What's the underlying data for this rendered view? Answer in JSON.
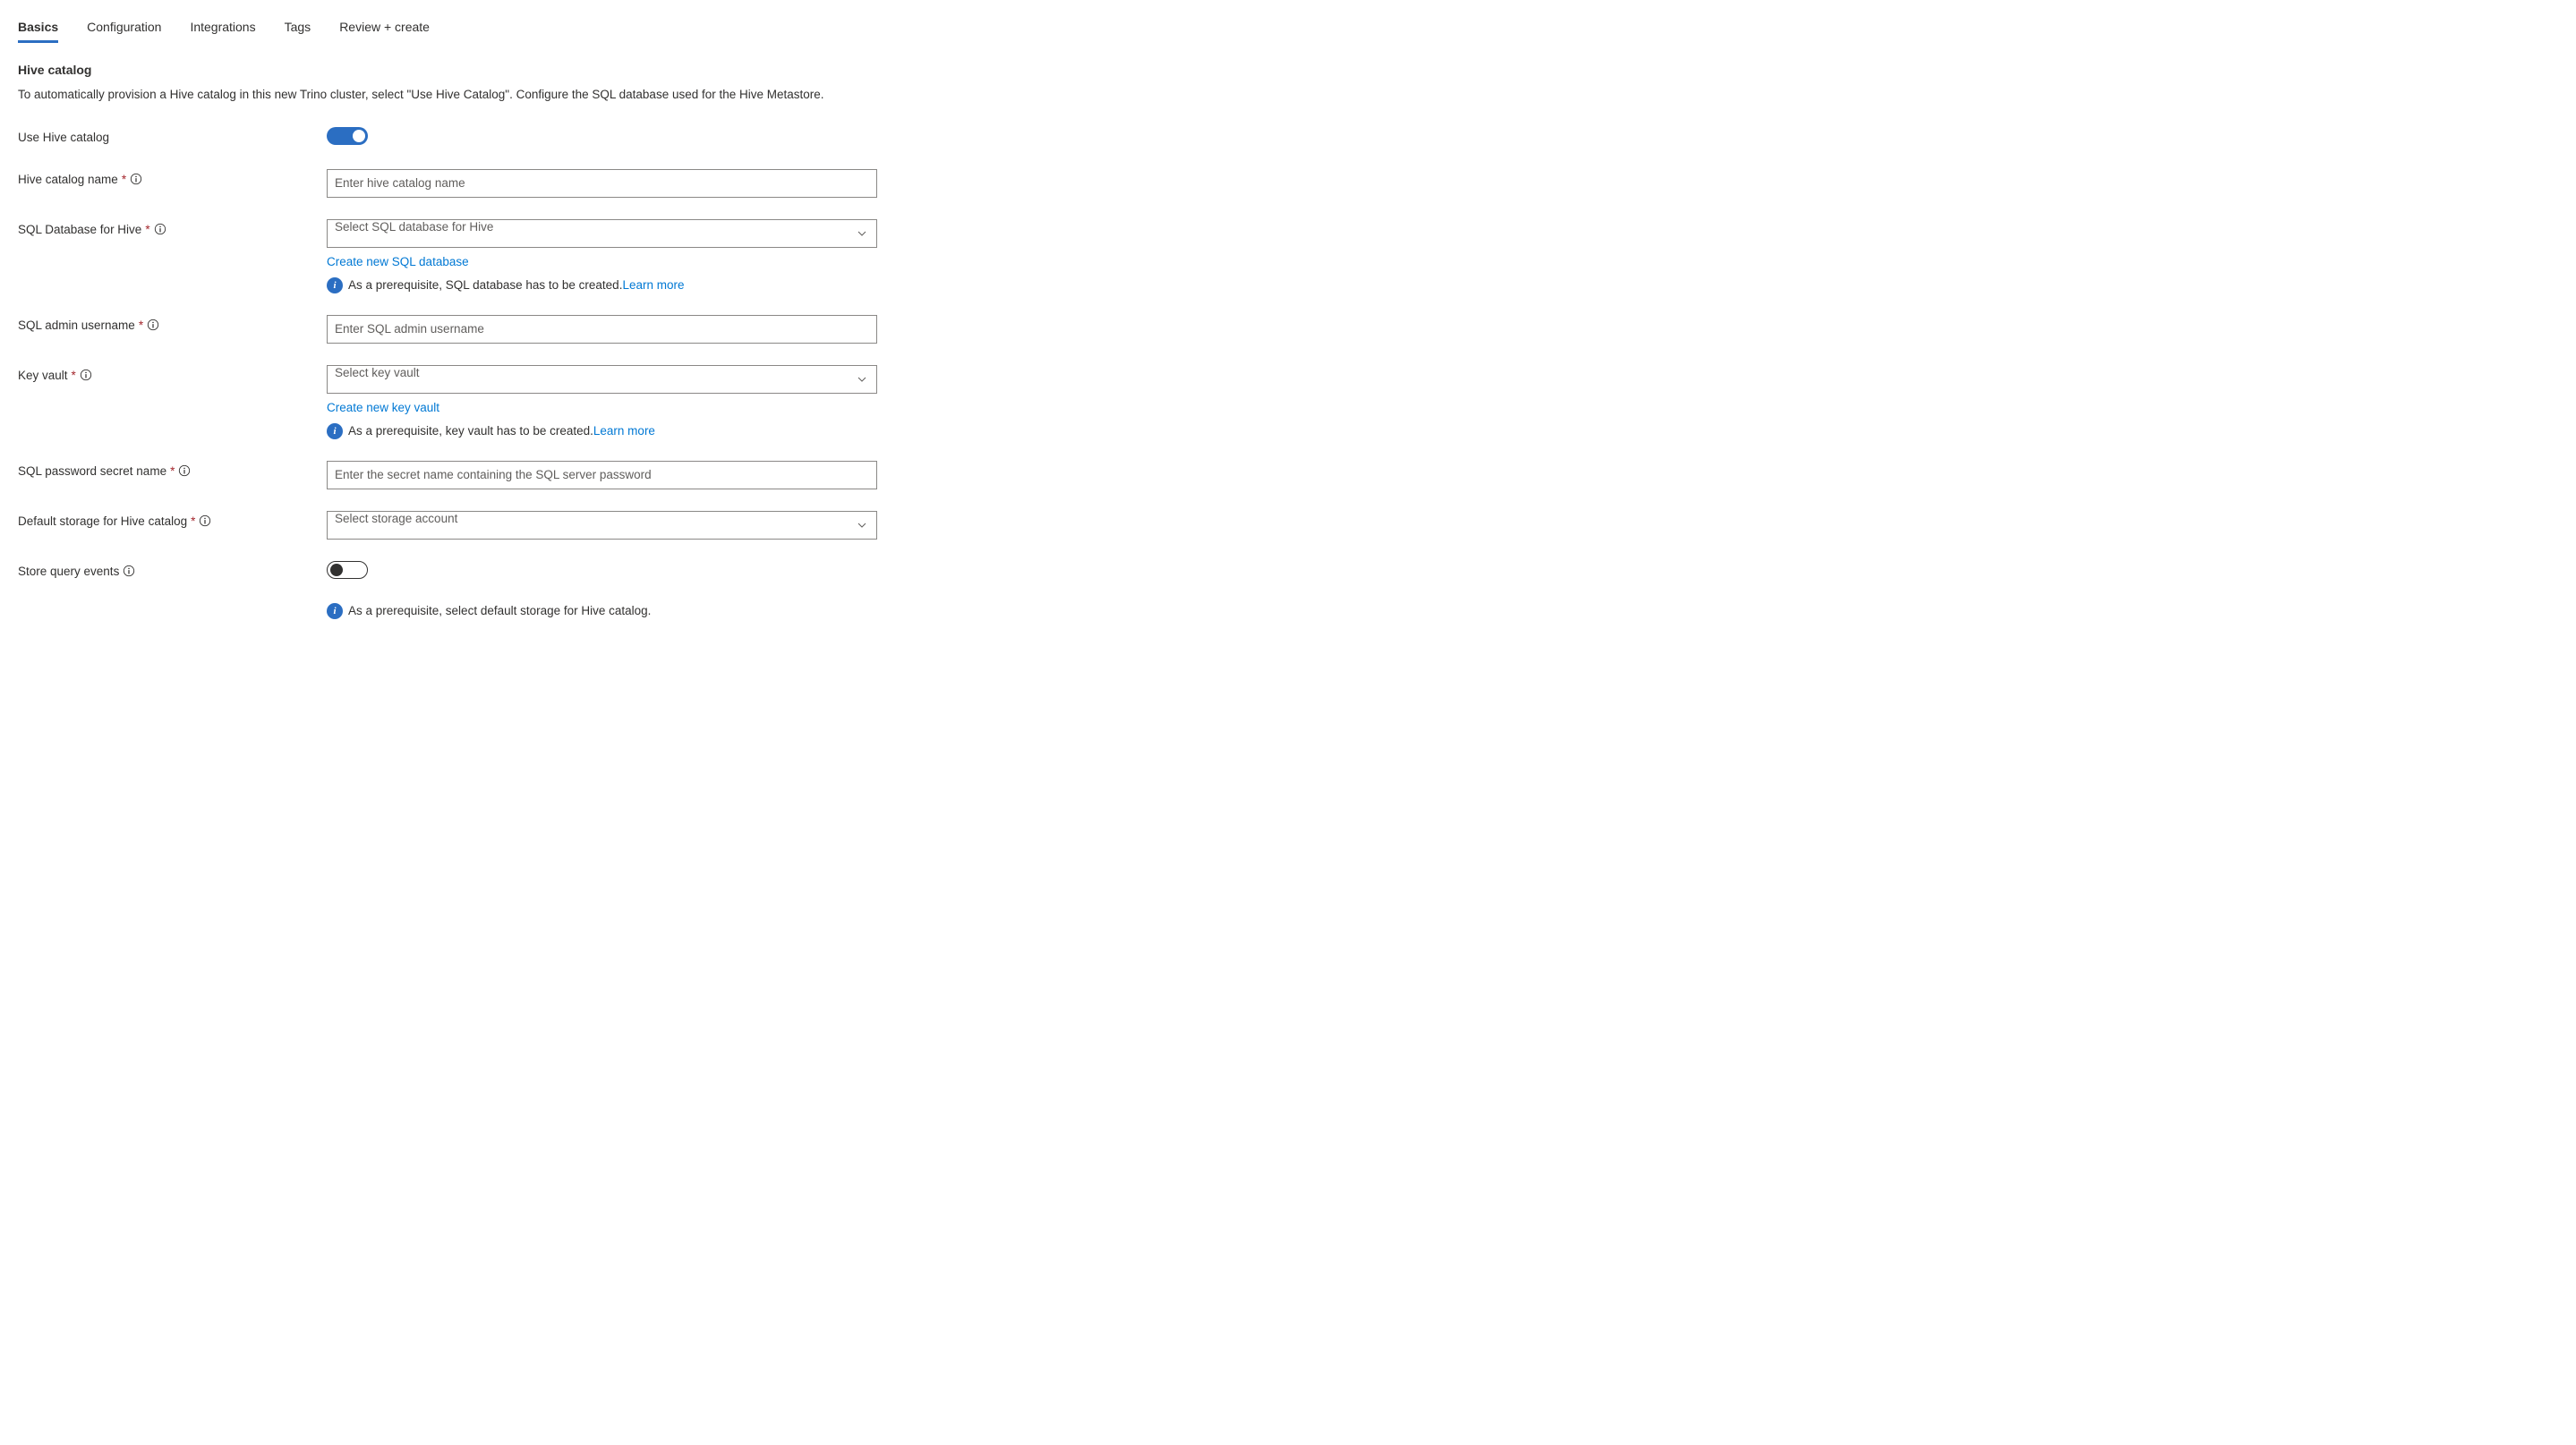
{
  "tabs": {
    "basics": "Basics",
    "configuration": "Configuration",
    "integrations": "Integrations",
    "tags": "Tags",
    "review_create": "Review + create"
  },
  "section": {
    "title": "Hive catalog",
    "description": "To automatically provision a Hive catalog in this new Trino cluster, select \"Use Hive Catalog\". Configure the SQL database used for the Hive Metastore."
  },
  "fields": {
    "use_hive_catalog": {
      "label": "Use Hive catalog"
    },
    "hive_catalog_name": {
      "label": "Hive catalog name",
      "placeholder": "Enter hive catalog name"
    },
    "sql_db_for_hive": {
      "label": "SQL Database for Hive",
      "placeholder": "Select SQL database for Hive",
      "create_link": "Create new SQL database",
      "prereq": "As a prerequisite, SQL database has to be created.",
      "learn_more": "Learn more"
    },
    "sql_admin_username": {
      "label": "SQL admin username",
      "placeholder": "Enter SQL admin username"
    },
    "key_vault": {
      "label": "Key vault",
      "placeholder": "Select key vault",
      "create_link": "Create new key vault",
      "prereq": "As a prerequisite, key vault has to be created.",
      "learn_more": "Learn more"
    },
    "sql_password_secret": {
      "label": "SQL password secret name",
      "placeholder": "Enter the secret name containing the SQL server password"
    },
    "default_storage": {
      "label": "Default storage for Hive catalog",
      "placeholder": "Select storage account"
    },
    "store_query_events": {
      "label": "Store query events",
      "prereq": "As a prerequisite, select default storage for Hive catalog."
    }
  }
}
